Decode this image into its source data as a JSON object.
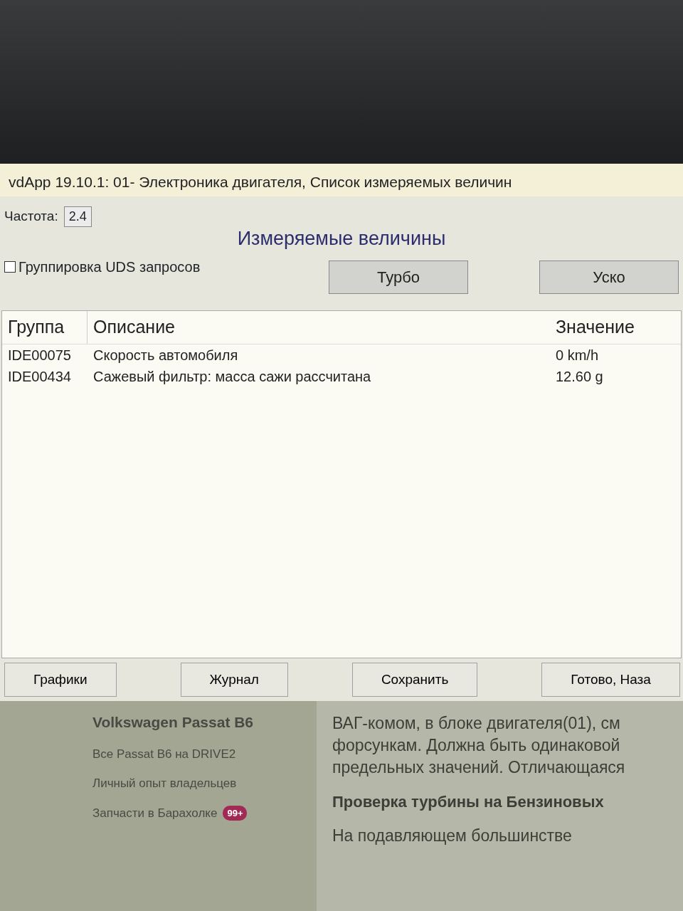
{
  "window": {
    "title": "vdApp 19.10.1: 01- Электроника двигателя,  Список измеряемых величин"
  },
  "frequency": {
    "label": "Частота:",
    "value": "2.4"
  },
  "heading": "Измеряемые величины",
  "grouping": {
    "label": "Группировка UDS запросов",
    "checked": false
  },
  "top_buttons": [
    "Турбо",
    "Уско"
  ],
  "table": {
    "columns": [
      "Группа",
      "Описание",
      "Значение"
    ],
    "rows": [
      {
        "group": "IDE00075",
        "description": "Скорость автомобиля",
        "value": "0 km/h"
      },
      {
        "group": "IDE00434",
        "description": "Сажевый фильтр: масса сажи рассчитана",
        "value": "12.60 g"
      }
    ]
  },
  "bottom_buttons": [
    "Графики",
    "Журнал",
    "Сохранить",
    "Готово, Наза"
  ],
  "web": {
    "sidebar": {
      "title": "Volkswagen Passat B6",
      "links": [
        {
          "label": "Все Passat B6 на DRIVE2"
        },
        {
          "label": "Личный опыт владельцев"
        },
        {
          "label": "Запчасти в Барахолке",
          "badge": "99+"
        }
      ]
    },
    "article": [
      {
        "kind": "text",
        "text": "ВАГ-комом, в блоке двигателя(01), см"
      },
      {
        "kind": "text",
        "text": "форсункам. Должна быть одинаковой"
      },
      {
        "kind": "text",
        "text": "предельных значений. Отличающаяся"
      },
      {
        "kind": "heading",
        "text": "Проверка турбины на Бензиновых"
      },
      {
        "kind": "text",
        "text": "На подавляющем большинстве"
      }
    ]
  }
}
